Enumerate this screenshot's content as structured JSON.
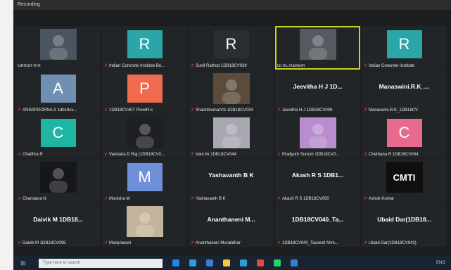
{
  "window": {
    "title": "Recording"
  },
  "participants": [
    {
      "label": "GIRISH H.R",
      "type": "photo",
      "photo_bg": "#4a5561",
      "muted": false
    },
    {
      "label": "Indian Concrete Institute Be...",
      "type": "avatar",
      "initial": "R",
      "color": "#2aa6a8",
      "muted": true
    },
    {
      "label": "Sunil Rathod 1DB18CV039",
      "type": "avatar",
      "initial": "R",
      "color": "#2b2e31",
      "muted": true
    },
    {
      "label": "Dr.RL.Ramesh",
      "type": "photo",
      "photo_bg": "#545a5f",
      "muted": false,
      "active": true
    },
    {
      "label": "Indian Concrete Institute",
      "type": "avatar",
      "initial": "R",
      "color": "#2aa6a8",
      "muted": true
    },
    {
      "label": "ANNAPOORNA S 1db18cv...",
      "type": "avatar",
      "initial": "A",
      "color": "#6f8fb3",
      "muted": true
    },
    {
      "label": "1DB19CV407 Preethi k",
      "type": "avatar",
      "initial": "P",
      "color": "#f06a4f",
      "muted": true
    },
    {
      "label": "ShashikumarVS 1DB18CV034",
      "type": "photo",
      "photo_bg": "#5b4b3b",
      "muted": true
    },
    {
      "label": "Jeevitha H J 1DB19CV009",
      "type": "name",
      "display_name": "Jeevitha H J 1D...",
      "muted": true
    },
    {
      "label": "Manaswini.R.K_1DB18CV",
      "type": "name",
      "display_name": "Manaswini.R.K_...",
      "muted": true
    },
    {
      "label": "Chaithra R",
      "type": "avatar",
      "initial": "C",
      "color": "#1fb5a3",
      "muted": true
    },
    {
      "label": "Vandana D Raj (1DB18CV0...",
      "type": "photo",
      "photo_bg": "#1d1f22",
      "muted": true
    },
    {
      "label": "Vani hk 1DB18CV044",
      "type": "photo",
      "photo_bg": "#a9a7b1",
      "muted": true
    },
    {
      "label": "Pradyuth Suresh 1DB18CV0...",
      "type": "photo",
      "photo_bg": "#b98ccf",
      "muted": true
    },
    {
      "label": "Chethana R 1DB19CV004",
      "type": "avatar",
      "initial": "C",
      "color": "#e86a8c",
      "muted": true
    },
    {
      "label": "Chandana N",
      "type": "photo",
      "photo_bg": "#15171a",
      "muted": true
    },
    {
      "label": "Monisha M",
      "type": "avatar",
      "initial": "M",
      "color": "#6f8fd9",
      "muted": true
    },
    {
      "label": "Yashavanth B K",
      "type": "name",
      "display_name": "Yashavanth B K",
      "muted": true
    },
    {
      "label": "Akash R S 1DB18CV050",
      "type": "name",
      "display_name": "Akash R S 1DB1...",
      "muted": true
    },
    {
      "label": "Ashok Kumar",
      "type": "logo",
      "logo_text": "CMTI",
      "muted": true
    },
    {
      "label": "Daivik M 1DB18CV008",
      "type": "name",
      "display_name": "Daivik M 1DB18...",
      "muted": true
    },
    {
      "label": "Manjularani",
      "type": "photo",
      "photo_bg": "#c3b59d",
      "muted": true
    },
    {
      "label": "Ananthaneni Muralidhar",
      "type": "name",
      "display_name": "Ananthaneni M...",
      "muted": true
    },
    {
      "label": "1DB18CV040_Tauseef Ahm...",
      "type": "name",
      "display_name": "1DB18CV040_Ta...",
      "muted": true
    },
    {
      "label": "Ubaid Dar(1DB18CV043)",
      "type": "name",
      "display_name": "Ubaid Dar(1DB18...",
      "muted": true
    }
  ],
  "taskbar": {
    "search_placeholder": "Type here to search",
    "icons": [
      "start-icon",
      "search-icon",
      "task-view-icon",
      "edge-icon",
      "explorer-icon",
      "store-icon",
      "chrome-icon",
      "whatsapp-icon",
      "zoom-icon"
    ],
    "icon_colors": [
      "#1e88e5",
      "#2d9cdb",
      "#3a7bd5",
      "#f2c94c",
      "#2d9cdb",
      "#e5483b",
      "#25d366",
      "#3a7bd5"
    ],
    "tray_text": "ENG"
  }
}
